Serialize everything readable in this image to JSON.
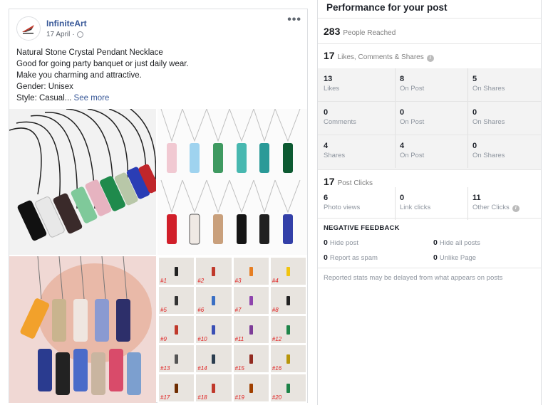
{
  "post": {
    "page_name": "InfiniteArt",
    "date": "17 April",
    "more_label": "•••",
    "lines": [
      "Natural Stone Crystal Pendant Necklace",
      "Good for going party banquet or just daily wear.",
      "Make you charming and attractive.",
      "Gender: Unisex"
    ],
    "last_line": "Style: Casual...",
    "see_more": "See more",
    "tiles": [
      "#1",
      "#2",
      "#3",
      "#4",
      "#5",
      "#6",
      "#7",
      "#8",
      "#9",
      "#10",
      "#11",
      "#12",
      "#13",
      "#14",
      "#15",
      "#16",
      "#17",
      "#18",
      "#19",
      "#20"
    ]
  },
  "performance": {
    "title": "Performance for your post",
    "reached_count": "283",
    "reached_label": "People Reached",
    "likes_count": "17",
    "likes_label": "Likes, Comments & Shares",
    "breakdown": [
      {
        "a": "13",
        "a_label": "Likes",
        "b": "8",
        "b_label": "On Post",
        "c": "5",
        "c_label": "On Shares"
      },
      {
        "a": "0",
        "a_label": "Comments",
        "b": "0",
        "b_label": "On Post",
        "c": "0",
        "c_label": "On Shares"
      },
      {
        "a": "4",
        "a_label": "Shares",
        "b": "4",
        "b_label": "On Post",
        "c": "0",
        "c_label": "On Shares"
      }
    ],
    "clicks_count": "17",
    "clicks_label": "Post Clicks",
    "clicks": {
      "a": "6",
      "a_label": "Photo views",
      "b": "0",
      "b_label": "Link clicks",
      "c": "11",
      "c_label": "Other Clicks"
    },
    "negative_title": "NEGATIVE FEEDBACK",
    "negative": [
      {
        "n": "0",
        "label": "Hide post"
      },
      {
        "n": "0",
        "label": "Hide all posts"
      },
      {
        "n": "0",
        "label": "Report as spam"
      },
      {
        "n": "0",
        "label": "Unlike Page"
      }
    ],
    "note": "Reported stats may be delayed from what appears on posts"
  },
  "colors": {
    "link": "#385898",
    "muted": "#8d949e",
    "band": "#f3f3f3"
  }
}
